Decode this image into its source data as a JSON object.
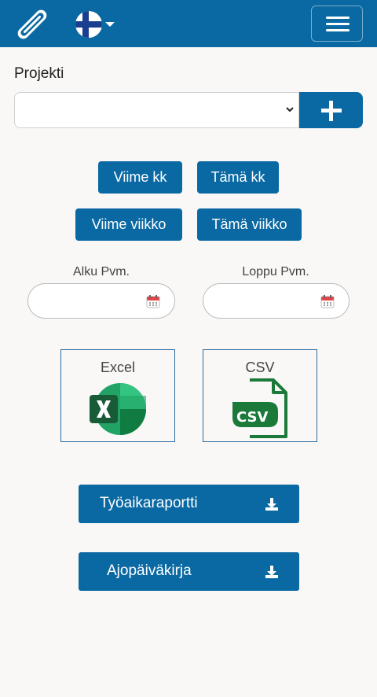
{
  "header": {
    "logo_icon": "paperclip-logo-icon",
    "language_flag": "finland-flag-icon",
    "menu_icon": "hamburger-menu-icon"
  },
  "project": {
    "label": "Projekti",
    "selected_value": "",
    "add_icon": "plus-icon"
  },
  "ranges": {
    "last_month": "Viime kk",
    "this_month": "Tämä kk",
    "last_week": "Viime viikko",
    "this_week": "Tämä viikko"
  },
  "dates": {
    "start_label": "Alku Pvm.",
    "end_label": "Loppu Pvm.",
    "start_value": "",
    "end_value": "",
    "calendar_icon": "calendar-icon"
  },
  "formats": {
    "excel_label": "Excel",
    "csv_label": "CSV"
  },
  "downloads": {
    "work_report": "Työaikaraportti",
    "drive_log": "Ajopäiväkirja",
    "download_icon": "download-icon"
  },
  "colors": {
    "primary": "#0a69a3",
    "excel_green": "#1f7a43",
    "csv_green": "#1b7a3a"
  }
}
